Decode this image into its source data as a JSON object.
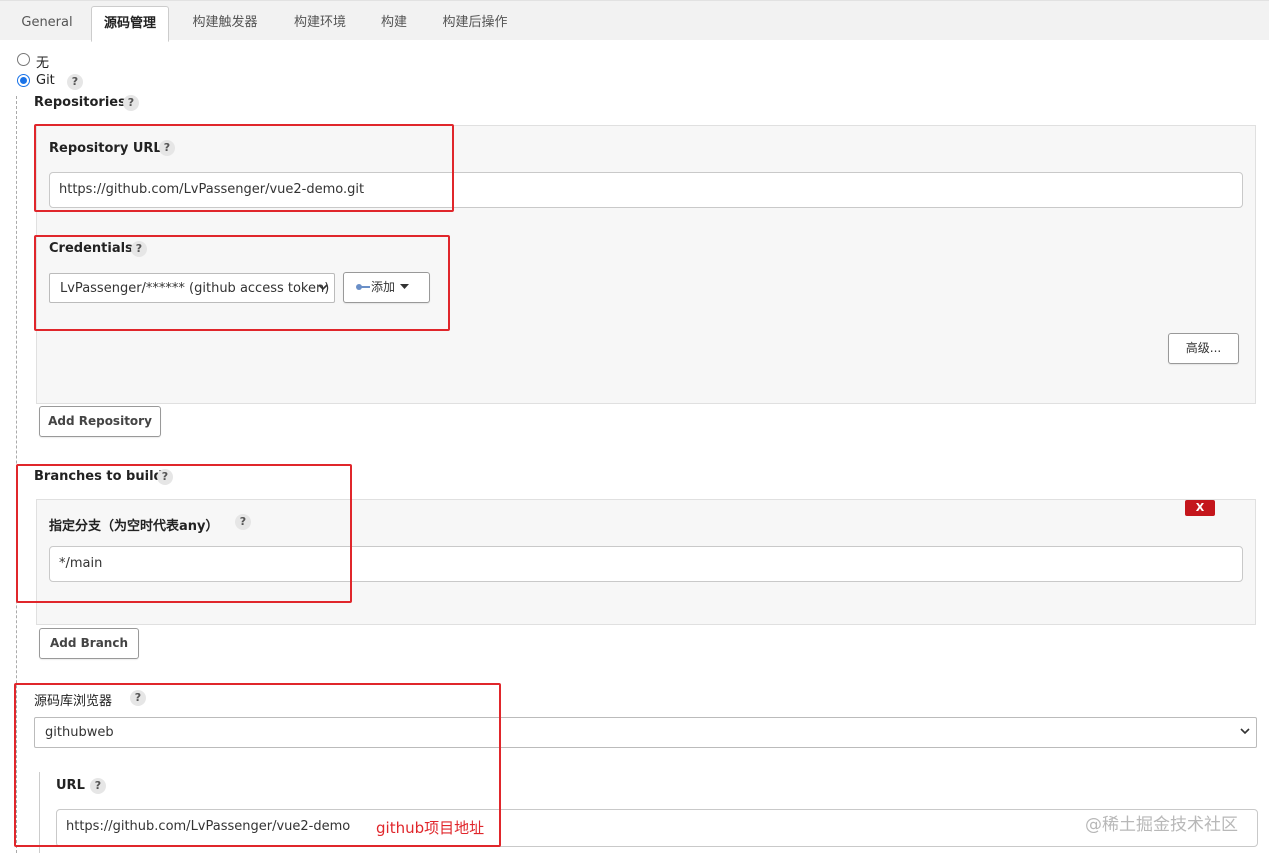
{
  "tabs": [
    {
      "label": "General"
    },
    {
      "label": "源码管理"
    },
    {
      "label": "构建触发器"
    },
    {
      "label": "构建环境"
    },
    {
      "label": "构建"
    },
    {
      "label": "构建后操作"
    }
  ],
  "scm": {
    "option_none": "无",
    "option_git": "Git",
    "help_glyph": "?"
  },
  "repositories": {
    "title": "Repositories",
    "url_label": "Repository URL",
    "url_value": "https://github.com/LvPassenger/vue2-demo.git",
    "credentials_label": "Credentials",
    "credentials_value": "LvPassenger/****** (github access token)",
    "add_credential_label": "添加",
    "advanced_label": "高级...",
    "add_repository_label": "Add Repository"
  },
  "branches": {
    "title": "Branches to build",
    "specifier_label": "指定分支（为空时代表any）",
    "specifier_value": "*/main",
    "delete_label": "X",
    "add_branch_label": "Add Branch"
  },
  "browser": {
    "label": "源码库浏览器",
    "value": "githubweb",
    "url_label": "URL",
    "url_value": "https://github.com/LvPassenger/vue2-demo"
  },
  "annotation": "github项目地址",
  "watermark": "@稀土掘金技术社区",
  "colors": {
    "highlight": "#e0262b",
    "radio_selected": "#1a73e8",
    "delete_button": "#c4161c"
  }
}
